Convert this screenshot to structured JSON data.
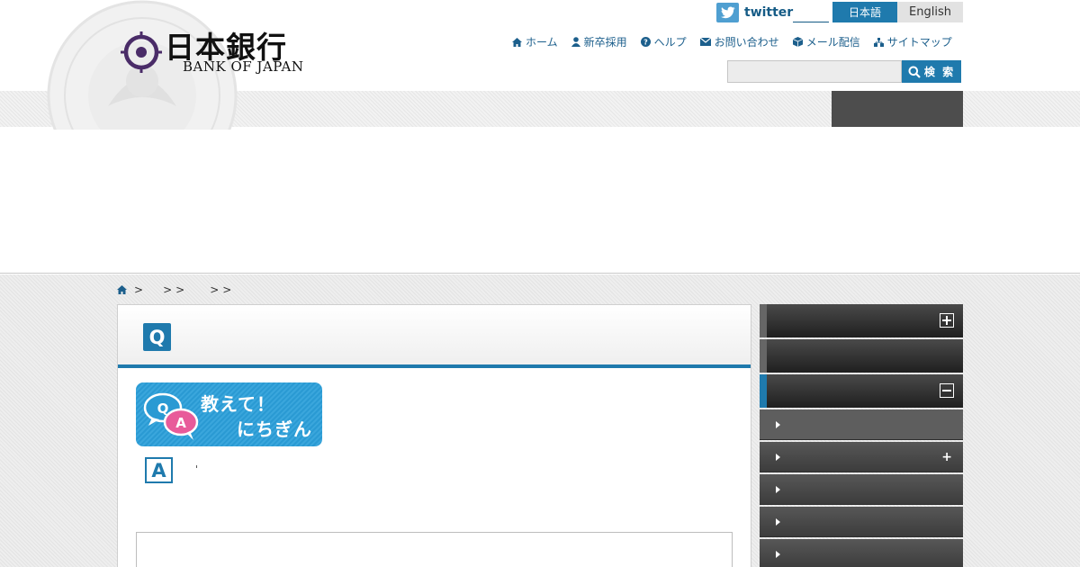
{
  "header": {
    "logo": {
      "jp": "日本銀行",
      "en": "BANK OF JAPAN"
    },
    "twitter": {
      "label": "twitter",
      "icon": "twitter-bird-icon"
    },
    "language": {
      "japanese": "日本語",
      "english": "English",
      "selected": "日本語"
    },
    "util_nav": [
      {
        "label": "ホーム",
        "icon": "home-icon"
      },
      {
        "label": "新卒採用",
        "icon": "person-icon"
      },
      {
        "label": "ヘルプ",
        "icon": "help-icon"
      },
      {
        "label": "お問い合わせ",
        "icon": "mail-icon"
      },
      {
        "label": "メール配信",
        "icon": "box-icon"
      },
      {
        "label": "サイトマップ",
        "icon": "sitemap-icon"
      }
    ],
    "search": {
      "value": "",
      "button_label": "検 索"
    }
  },
  "breadcrumb": {
    "separators": [
      ">",
      ">",
      ">",
      ">",
      ">"
    ]
  },
  "article": {
    "q_mark": "Q",
    "a_mark": "A",
    "qa_banner": {
      "line1": "教えて！",
      "line2": "にちぎん",
      "bubble_q": "Q",
      "bubble_a": "A"
    }
  },
  "sidebar": {
    "sections": [
      {
        "state": "collapsed",
        "toggle_icon": "plus-square-icon"
      },
      {
        "state": "none"
      },
      {
        "state": "expanded",
        "toggle_icon": "minus-square-icon"
      }
    ],
    "sub_items": [
      {
        "current": true,
        "has_children": false
      },
      {
        "current": false,
        "has_children": true,
        "expand_symbol": "+"
      },
      {
        "current": false,
        "has_children": false
      },
      {
        "current": false,
        "has_children": false
      },
      {
        "current": false,
        "has_children": false
      }
    ]
  },
  "colors": {
    "accent": "#1f7aad",
    "nav_dark": "#4d4d4d",
    "logo_purple": "#4a2c68",
    "qa_pink": "#e85b9a"
  }
}
